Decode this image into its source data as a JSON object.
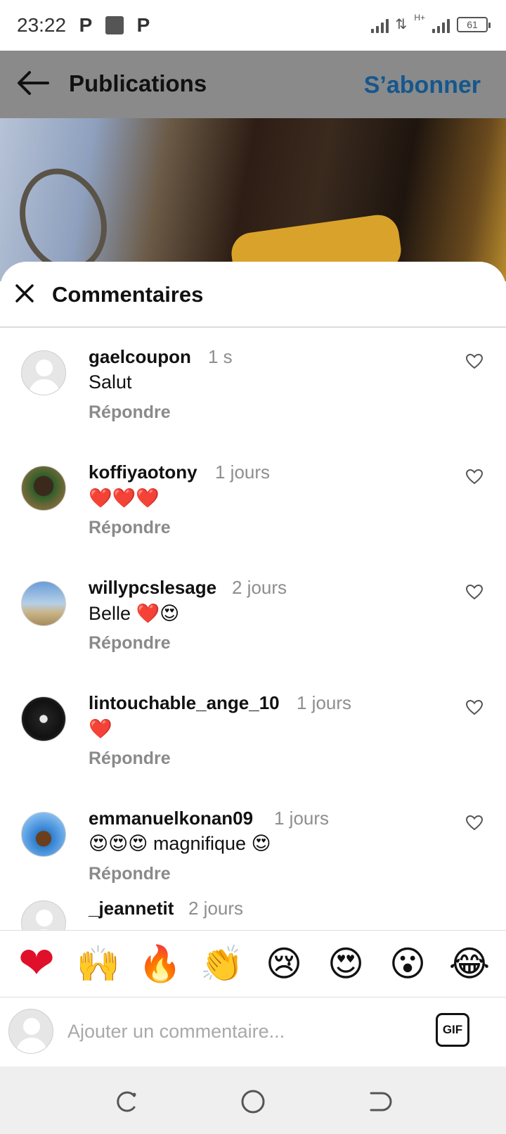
{
  "status_bar": {
    "time": "23:22",
    "left_icons": [
      "P",
      "P"
    ],
    "battery": "61",
    "network": "H+"
  },
  "header": {
    "title": "Publications",
    "subscribe": "S’abonner"
  },
  "sheet": {
    "title": "Commentaires"
  },
  "comments": [
    {
      "username": "gaelcoupon",
      "time": "1 s",
      "text": "Salut",
      "reply": "Répondre"
    },
    {
      "username": "koffiyaotony",
      "time": "1 jours",
      "text": "❤️❤️❤️",
      "reply": "Répondre"
    },
    {
      "username": "willypcslesage",
      "time": "2 jours",
      "text": "Belle ❤️😍",
      "reply": "Répondre"
    },
    {
      "username": "lintouchable_ange_10",
      "time": "1 jours",
      "text": "❤️",
      "reply": "Répondre"
    },
    {
      "username": "emmanuelkonan09",
      "time": "1 jours",
      "text": "😍😍😍 magnifique 😍",
      "reply": "Répondre"
    }
  ],
  "partial_comment": {
    "username": "_jeannetit",
    "time": "2 jours"
  },
  "emoji_bar": [
    "❤",
    "🙌",
    "🔥",
    "👏",
    "😢",
    "😍",
    "😮",
    "😂"
  ],
  "input": {
    "placeholder": "Ajouter un commentaire...",
    "gif": "GIF"
  },
  "colors": {
    "subscribe": "#14578e",
    "header_bg": "#8a8a8a",
    "muted": "#8e8e8e"
  }
}
